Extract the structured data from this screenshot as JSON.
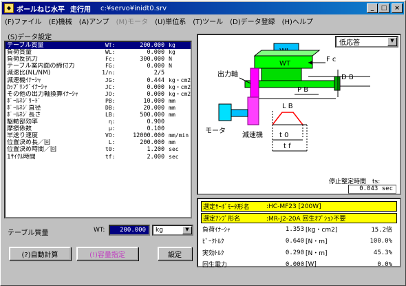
{
  "title": {
    "app": "ボールねじ水平",
    "mode": "走行用",
    "path": "c:¥servo¥inidt0.srv",
    "sys_icon": "ball-screw-app-icon"
  },
  "menu": [
    "(F)ファイル",
    "(E)機械",
    "(A)アンプ",
    "(M)モータ",
    "(U)単位系",
    "(T)ツール",
    "(D)データ登録",
    "(H)ヘルプ"
  ],
  "menu_disabled": "(M)モータ",
  "section_label": "(S)データ設定",
  "params": [
    {
      "name": "テーブル質量",
      "sym": "WT:",
      "val": "200.000",
      "unit": "kg"
    },
    {
      "name": "負荷質量",
      "sym": "WL:",
      "val": "0.000",
      "unit": "kg"
    },
    {
      "name": "負荷反抗力",
      "sym": "Fc:",
      "val": "300.000",
      "unit": "N"
    },
    {
      "name": "テーブル案内面の締付力",
      "sym": "FG:",
      "val": "0.000",
      "unit": "N"
    },
    {
      "name": "減速比(NL/NM)",
      "sym": "1/n:",
      "val": "2/5",
      "unit": ""
    },
    {
      "name": "減速機ｲﾅｰｼｬ",
      "sym": "JG:",
      "val": "0.444",
      "unit": "kg・cm2"
    },
    {
      "name": "ｶｯﾌﾟﾘﾝｸﾞｲﾅｰｼｬ",
      "sym": "JC:",
      "val": "0.000",
      "unit": "kg・cm2"
    },
    {
      "name": "その他の出力軸換算ｲﾅｰｼｬ",
      "sym": "JO:",
      "val": "0.000",
      "unit": "kg・cm2"
    },
    {
      "name": "ﾎﾞｰﾙﾈｼﾞﾘｰﾄﾞ",
      "sym": "PB:",
      "val": "10.000",
      "unit": "mm"
    },
    {
      "name": "ﾎﾞｰﾙﾈｼﾞ直径",
      "sym": "DB:",
      "val": "20.000",
      "unit": "mm"
    },
    {
      "name": "ﾎﾞｰﾙﾈｼﾞ長さ",
      "sym": "LB:",
      "val": "500.000",
      "unit": "mm"
    },
    {
      "name": "駆動部効率",
      "sym": "η:",
      "val": "0.900",
      "unit": ""
    },
    {
      "name": "摩擦係数",
      "sym": "μ:",
      "val": "0.100",
      "unit": ""
    },
    {
      "name": "早送り速度",
      "sym": "VO:",
      "val": "12000.000",
      "unit": "mm/min"
    },
    {
      "name": "位置決め長／回",
      "sym": "L:",
      "val": "200.000",
      "unit": "mm"
    },
    {
      "name": "位置決め時間／回",
      "sym": "t0:",
      "val": "1.200",
      "unit": "sec"
    },
    {
      "name": "1ｻｲｸﾙ時間",
      "sym": "tf:",
      "val": "2.000",
      "unit": "sec"
    }
  ],
  "response_dropdown": "低応答",
  "diagram": {
    "wl": "WL",
    "wt": "WT",
    "fc": "F c",
    "db": "D B",
    "pb": "P B",
    "lb": "L B",
    "output_shaft": "出力軸",
    "motor": "モータ",
    "reducer": "減速機",
    "t0": "t 0",
    "tf": "t f"
  },
  "settle": {
    "label": "停止整定時間　ts:",
    "value": "0.043 sec"
  },
  "results": {
    "servo_label": "選定ｻｰﾎﾞﾓｰﾀ形名",
    "servo_value": ":HC-MF23 [200W]",
    "amp_label": "選定ｱﾝﾌﾟ形名",
    "amp_value": ":MR-J2-20A 回生ｵﾌﾟｼｮﾝ不要",
    "rows": [
      {
        "label": "負荷ｲﾅｰｼｬ",
        "val": "1.353",
        "unit": "[kg・cm2]",
        "pct": "15.2倍"
      },
      {
        "label": "ﾋﾟｰｸﾄﾙｸ",
        "val": "0.640",
        "unit": "[N・m]",
        "pct": "100.0%"
      },
      {
        "label": "実効ﾄﾙｸ",
        "val": "0.290",
        "unit": "[N・m]",
        "pct": "45.3%"
      },
      {
        "label": "回生電力",
        "val": "0.000",
        "unit": "[W]",
        "pct": "0.0%"
      }
    ]
  },
  "edit": {
    "label": "テーブル質量",
    "sym": "WT:",
    "value": "200.000",
    "unit": "kg"
  },
  "buttons": {
    "auto_calc": "(?)自動計算",
    "capacity": "(!)容量指定",
    "set": "設定"
  },
  "colors": {
    "title_bar": "#000080",
    "selection": "#000080",
    "highlight": "#ffff00",
    "green": "#00ff00",
    "magenta": "#ff00ff",
    "cyan": "#00c0ff"
  }
}
